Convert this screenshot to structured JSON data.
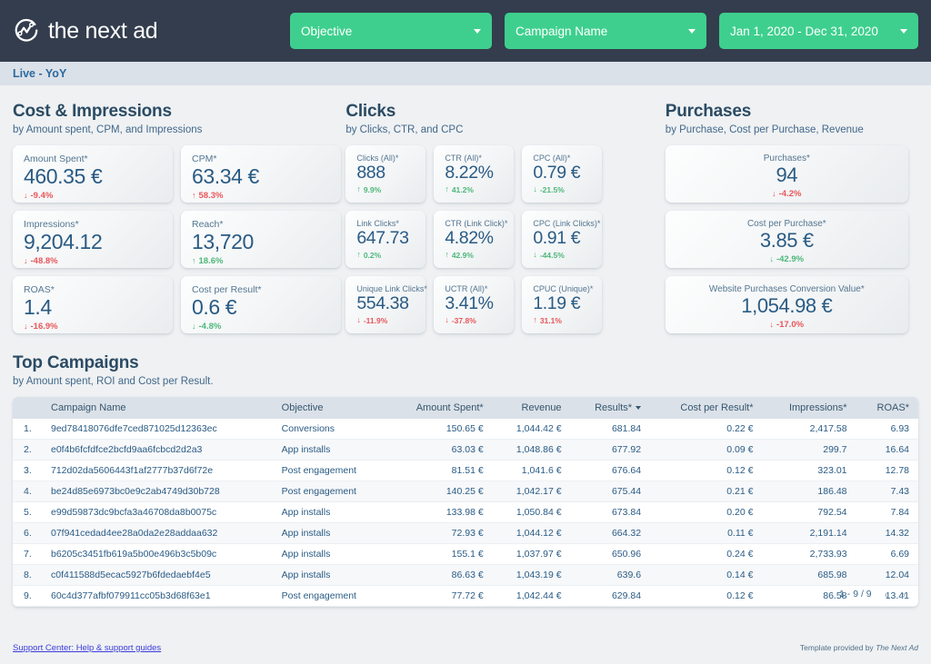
{
  "brand": {
    "name": "the next ad",
    "logo_icon": "circular-chart-logo-icon",
    "accent_green": "#3ecf8e",
    "header_dark": "#333d4d"
  },
  "header": {
    "filters": [
      {
        "label": "Objective",
        "icon": "chevron-down-icon"
      },
      {
        "label": "Campaign Name",
        "icon": "chevron-down-icon"
      },
      {
        "label": "Jan 1, 2020 - Dec 31, 2020",
        "icon": "chevron-down-icon"
      }
    ]
  },
  "livebar": {
    "label": "Live - YoY"
  },
  "sections": {
    "cost": {
      "title": "Cost & Impressions",
      "subtitle": "by Amount spent, CPM, and Impressions",
      "cards": [
        {
          "label": "Amount Spent*",
          "value": "460.35 €",
          "delta": "-9.4%",
          "dir": "down",
          "tone": "bad"
        },
        {
          "label": "CPM*",
          "value": "63.34 €",
          "delta": "58.3%",
          "dir": "up",
          "tone": "bad"
        },
        {
          "label": "Impressions*",
          "value": "9,204.12",
          "delta": "-48.8%",
          "dir": "down",
          "tone": "bad"
        },
        {
          "label": "Reach*",
          "value": "13,720",
          "delta": "18.6%",
          "dir": "up",
          "tone": "good"
        },
        {
          "label": "ROAS*",
          "value": "1.4",
          "delta": "-16.9%",
          "dir": "down",
          "tone": "bad"
        },
        {
          "label": "Cost per Result*",
          "value": "0.6 €",
          "delta": "-4.8%",
          "dir": "down",
          "tone": "good"
        }
      ]
    },
    "clicks": {
      "title": "Clicks",
      "subtitle": "by Clicks, CTR, and CPC",
      "cards": [
        {
          "label": "Clicks (All)*",
          "value": "888",
          "delta": "9.9%",
          "dir": "up",
          "tone": "good"
        },
        {
          "label": "CTR (All)*",
          "value": "8.22%",
          "delta": "41.2%",
          "dir": "up",
          "tone": "good"
        },
        {
          "label": "CPC (All)*",
          "value": "0.79 €",
          "delta": "-21.5%",
          "dir": "down",
          "tone": "good"
        },
        {
          "label": "Link Clicks*",
          "value": "647.73",
          "delta": "0.2%",
          "dir": "up",
          "tone": "good"
        },
        {
          "label": "CTR (Link Click)*",
          "value": "4.82%",
          "delta": "42.9%",
          "dir": "up",
          "tone": "good"
        },
        {
          "label": "CPC (Link Clicks)*",
          "value": "0.91 €",
          "delta": "-44.5%",
          "dir": "down",
          "tone": "good"
        },
        {
          "label": "Unique Link Clicks*",
          "value": "554.38",
          "delta": "-11.9%",
          "dir": "down",
          "tone": "bad"
        },
        {
          "label": "UCTR (All)*",
          "value": "3.41%",
          "delta": "-37.8%",
          "dir": "down",
          "tone": "bad"
        },
        {
          "label": "CPUC (Unique)*",
          "value": "1.19 €",
          "delta": "31.1%",
          "dir": "up",
          "tone": "bad"
        }
      ]
    },
    "purchases": {
      "title": "Purchases",
      "subtitle": "by Purchase, Cost per Purchase, Revenue",
      "cards": [
        {
          "label": "Purchases*",
          "value": "94",
          "delta": "-4.2%",
          "dir": "down",
          "tone": "bad"
        },
        {
          "label": "Cost per Purchase*",
          "value": "3.85 €",
          "delta": "-42.9%",
          "dir": "down",
          "tone": "good"
        },
        {
          "label": "Website Purchases Conversion Value*",
          "value": "1,054.98 €",
          "delta": "-17.0%",
          "dir": "down",
          "tone": "bad"
        }
      ]
    }
  },
  "campaigns": {
    "title": "Top Campaigns",
    "subtitle": "by Amount spent, ROI and Cost per Result.",
    "columns": [
      "Campaign Name",
      "Objective",
      "Amount Spent*",
      "Revenue",
      "Results*",
      "Cost per Result*",
      "Impressions*",
      "ROAS*"
    ],
    "sorted_column": "Results*",
    "rows": [
      {
        "idx": "1.",
        "name": "9ed78418076dfe7ced871025d12363ec",
        "objective": "Conversions",
        "amount_spent": "150.65 €",
        "revenue": "1,044.42 €",
        "results": "681.84",
        "cost_per_result": "0.22 €",
        "impressions": "2,417.58",
        "roas": "6.93"
      },
      {
        "idx": "2.",
        "name": "e0f4b6fcfdfce2bcfd9aa6fcbcd2d2a3",
        "objective": "App installs",
        "amount_spent": "63.03 €",
        "revenue": "1,048.86 €",
        "results": "677.92",
        "cost_per_result": "0.09 €",
        "impressions": "299.7",
        "roas": "16.64"
      },
      {
        "idx": "3.",
        "name": "712d02da5606443f1af2777b37d6f72e",
        "objective": "Post engagement",
        "amount_spent": "81.51 €",
        "revenue": "1,041.6 €",
        "results": "676.64",
        "cost_per_result": "0.12 €",
        "impressions": "323.01",
        "roas": "12.78"
      },
      {
        "idx": "4.",
        "name": "be24d85e6973bc0e9c2ab4749d30b728",
        "objective": "Post engagement",
        "amount_spent": "140.25 €",
        "revenue": "1,042.17 €",
        "results": "675.44",
        "cost_per_result": "0.21 €",
        "impressions": "186.48",
        "roas": "7.43"
      },
      {
        "idx": "5.",
        "name": "e99d59873dc9bcfa3a46708da8b0075c",
        "objective": "App installs",
        "amount_spent": "133.98 €",
        "revenue": "1,050.84 €",
        "results": "673.84",
        "cost_per_result": "0.20 €",
        "impressions": "792.54",
        "roas": "7.84"
      },
      {
        "idx": "6.",
        "name": "07f941cedad4ee28a0da2e28addaa632",
        "objective": "App installs",
        "amount_spent": "72.93 €",
        "revenue": "1,044.12 €",
        "results": "664.32",
        "cost_per_result": "0.11 €",
        "impressions": "2,191.14",
        "roas": "14.32"
      },
      {
        "idx": "7.",
        "name": "b6205c3451fb619a5b00e496b3c5b09c",
        "objective": "App installs",
        "amount_spent": "155.1 €",
        "revenue": "1,037.97 €",
        "results": "650.96",
        "cost_per_result": "0.24 €",
        "impressions": "2,733.93",
        "roas": "6.69"
      },
      {
        "idx": "8.",
        "name": "c0f411588d5ecac5927b6fdedaebf4e5",
        "objective": "App installs",
        "amount_spent": "86.63 €",
        "revenue": "1,043.19 €",
        "results": "639.6",
        "cost_per_result": "0.14 €",
        "impressions": "685.98",
        "roas": "12.04"
      },
      {
        "idx": "9.",
        "name": "60c4d377afbf079911cc05b3d68f63e1",
        "objective": "Post engagement",
        "amount_spent": "77.72 €",
        "revenue": "1,042.44 €",
        "results": "629.84",
        "cost_per_result": "0.12 €",
        "impressions": "86.58",
        "roas": "13.41"
      }
    ],
    "pagination": {
      "range": "1 - 9 / 9",
      "prev_icon": "chevron-left-icon",
      "next_icon": "chevron-right-icon"
    }
  },
  "footer": {
    "link": "Support Center: Help & support guides",
    "note_prefix": "Template provided by ",
    "note_brand": "The Next Ad"
  }
}
